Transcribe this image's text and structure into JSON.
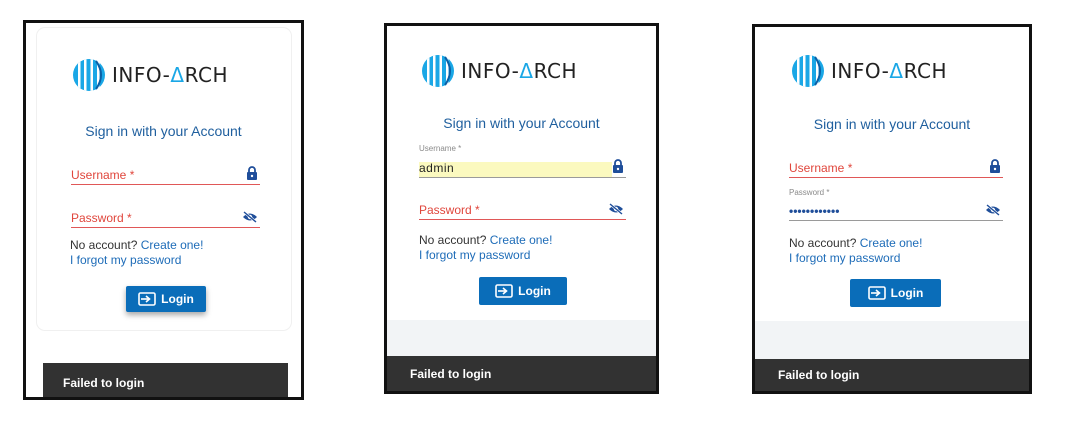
{
  "app": {
    "brand": "INFO-ARCH",
    "brand_parts": {
      "a": "INFO-",
      "delta": "Δ",
      "b": "RCH"
    },
    "heading": "Sign in with your Account"
  },
  "form": {
    "username_label": "Username *",
    "password_label": "Password *",
    "username_small_label": "Username *",
    "password_small_label": "Password *",
    "username_value": "admin",
    "password_value": "••••••••••••",
    "no_account_text": "No account?",
    "create_link": "Create one!",
    "forgot_link": "I forgot my password",
    "login_label": "Login"
  },
  "toast": {
    "message": "Failed to login"
  },
  "icons": {
    "username": "lock-icon",
    "password": "eye-off-icon",
    "login": "login-arrow-icon"
  },
  "colors": {
    "brand_blue": "#0a6db9",
    "required_red": "#e0463c",
    "heading_blue": "#1f5f9e",
    "toast_bg": "#323232"
  }
}
